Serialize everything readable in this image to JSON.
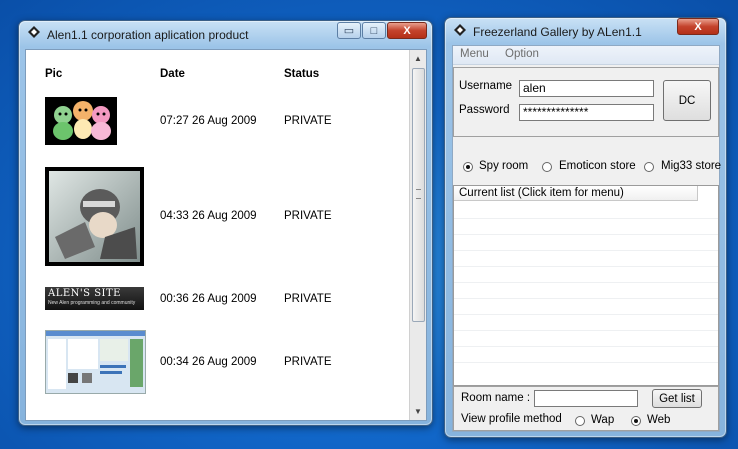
{
  "left_window": {
    "title": "Alen1.1 corporation aplication product",
    "controls": {
      "minimize": "▭",
      "maximize": "□",
      "close": "X"
    },
    "columns": {
      "pic": "Pic",
      "date": "Date",
      "status": "Status"
    },
    "rows": [
      {
        "thumbnail": "cartoon-animals-image",
        "date": "07:27 26 Aug 2009",
        "status": "PRIVATE"
      },
      {
        "thumbnail": "anime-character-image",
        "date": "04:33 26 Aug 2009",
        "status": "PRIVATE"
      },
      {
        "thumbnail": "alens-site-banner-image",
        "date": "00:36 26 Aug 2009",
        "status": "PRIVATE"
      },
      {
        "thumbnail": "screenshot-image",
        "date": "00:34 26 Aug 2009",
        "status": "PRIVATE"
      }
    ],
    "banner_text": "ALEN'S SITE",
    "banner_subtext": "New Alen programming and community"
  },
  "right_window": {
    "title": "Freezerland Gallery by ALen1.1",
    "close": "X",
    "menu": [
      "Menu",
      "Option"
    ],
    "login": {
      "username_label": "Username",
      "username_value": "alen",
      "password_label": "Password",
      "password_value": "**************",
      "dc_button": "DC"
    },
    "modes": [
      {
        "label": "Spy room",
        "selected": true
      },
      {
        "label": "Emoticon store",
        "selected": false
      },
      {
        "label": "Mig33 store",
        "selected": false
      }
    ],
    "list_header": "Current list (Click item for menu)",
    "room": {
      "label": "Room name :",
      "value": "",
      "button": "Get list"
    },
    "profile": {
      "label": "View profile method",
      "options": [
        {
          "label": "Wap",
          "selected": false
        },
        {
          "label": "Web",
          "selected": true
        }
      ]
    }
  },
  "colors": {
    "desktop": "#1166c8",
    "window_frame": "#9cc4e8",
    "close_button": "#c4432c"
  }
}
